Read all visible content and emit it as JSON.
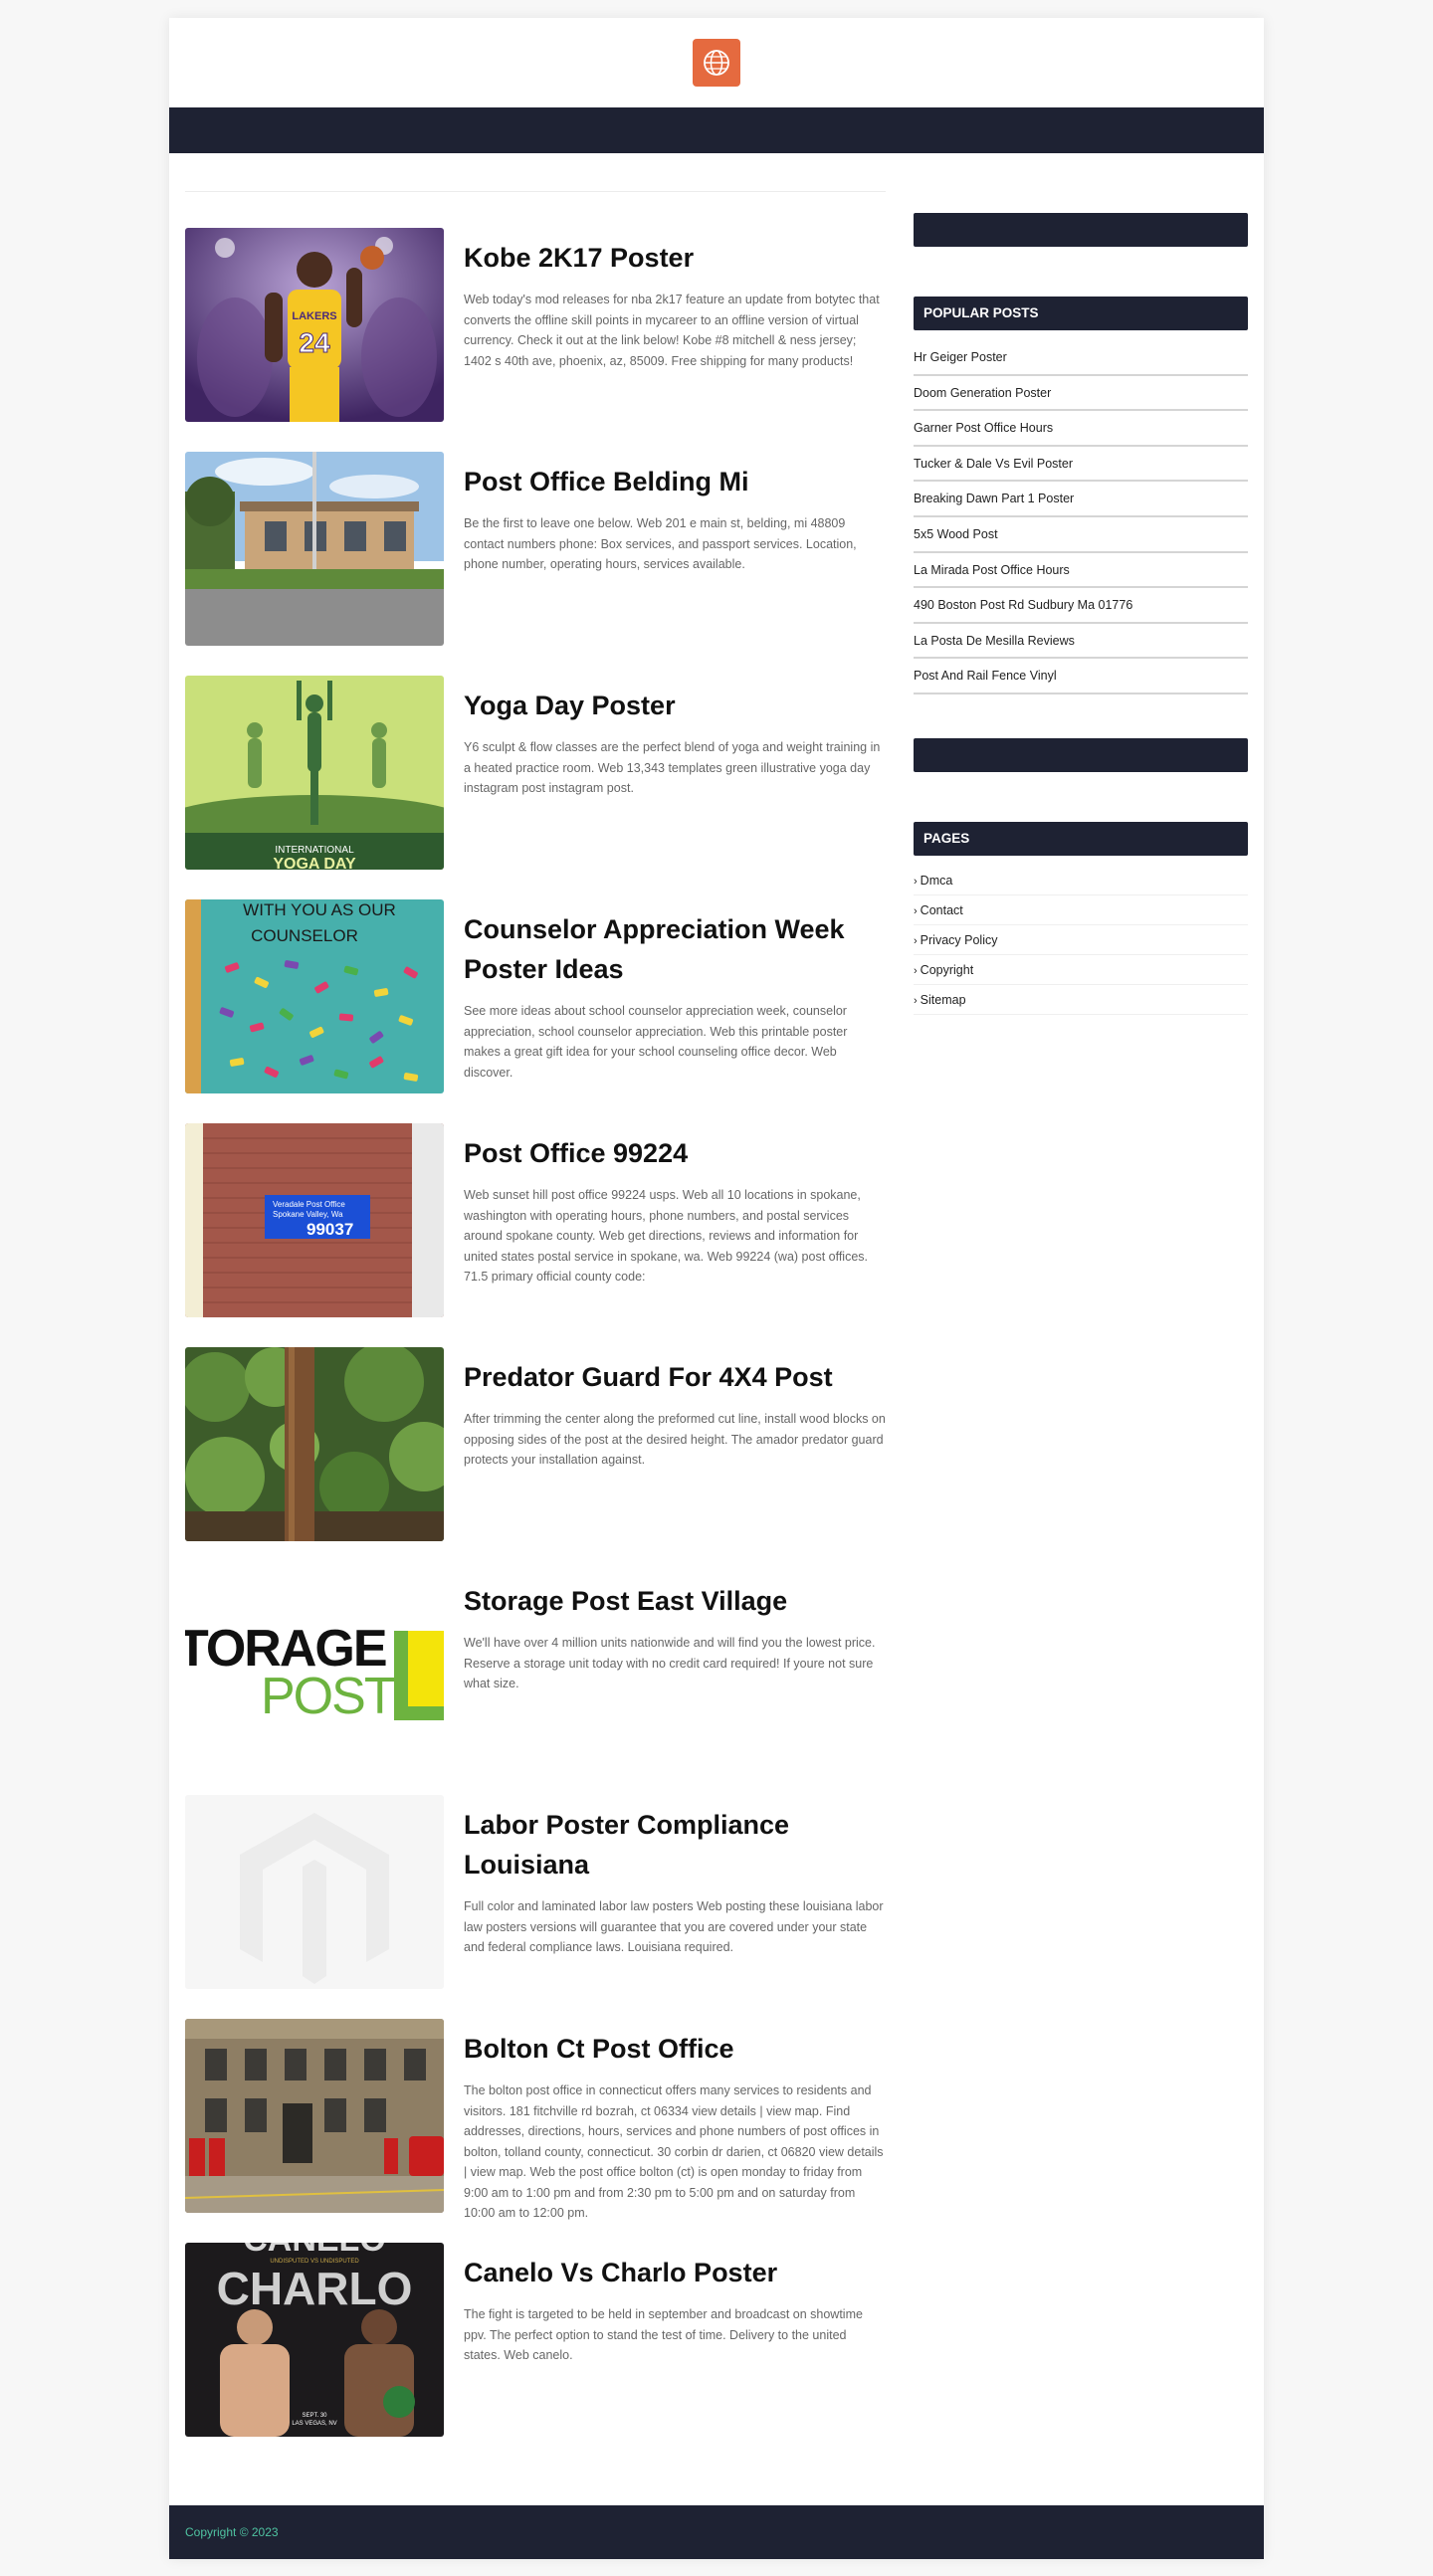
{
  "posts": [
    {
      "title": "Kobe 2K17 Poster",
      "excerpt": "Web today's mod releases for nba 2k17 feature an update from botytec that converts the offline skill points in mycareer to an offline version of virtual currency. Check it out at the link below! Kobe #8 mitchell & ness jersey; 1402 s 40th ave, phoenix, az, 85009. Free shipping for many products!",
      "image_text": [
        "LAKERS",
        "24"
      ]
    },
    {
      "title": "Post Office Belding Mi",
      "excerpt": "Be the first to leave one below. Web 201 e main st, belding, mi 48809 contact numbers phone: Box services, and passport services. Location, phone number, operating hours, services available."
    },
    {
      "title": "Yoga Day Poster",
      "excerpt": "Y6 sculpt & flow classes are the perfect blend of yoga and weight training in a heated practice room. Web 13,343 templates green illustrative yoga day instagram post instagram post.",
      "image_text": [
        "INTERNATIONAL",
        "YOGA DAY"
      ]
    },
    {
      "title": "Counselor Appreciation Week Poster Ideas",
      "excerpt": "See more ideas about school counselor appreciation week, counselor appreciation, school counselor appreciation. Web this printable poster makes a great gift idea for your school counseling office decor. Web discover.",
      "image_text": [
        "WITH YOU AS OUR",
        "COUNSELOR"
      ]
    },
    {
      "title": "Post Office 99224",
      "excerpt": "Web sunset hill post office 99224 usps. Web all 10 locations in spokane, washington with operating hours, phone numbers, and postal services around spokane county. Web get directions, reviews and information for united states postal service in spokane, wa. Web 99224 (wa) post offices. 71.5 primary official county code:",
      "image_text": [
        "Veradale Post Office",
        "Spokane Valley, Wa",
        "99037"
      ]
    },
    {
      "title": "Predator Guard For 4X4 Post",
      "excerpt": "After trimming the center along the preformed cut line, install wood blocks on opposing sides of the post at the desired height. The amador predator guard protects your installation against."
    },
    {
      "title": "Storage Post East Village",
      "excerpt": "We'll have over 4 million units nationwide and will find you the lowest price. Reserve a storage unit today with no credit card required! If youre not sure what size.",
      "image_text": [
        "TORAGE",
        "POST"
      ]
    },
    {
      "title": "Labor Poster Compliance Louisiana",
      "excerpt": "Full color and laminated labor law posters Web posting these louisiana labor law posters versions will guarantee that you are covered under your state and federal compliance laws. Louisiana required."
    },
    {
      "title": "Bolton Ct Post Office",
      "excerpt": "The bolton post office in connecticut offers many services to residents and visitors. 181 fitchville rd bozrah, ct 06334 view details | view map. Find addresses, directions, hours, services and phone numbers of post offices in bolton, tolland county, connecticut. 30 corbin dr darien, ct 06820 view details | view map. Web the post office bolton (ct) is open monday to friday from 9:00 am to 1:00 pm and from 2:30 pm to 5:00 pm and on saturday from 10:00 am to 12:00 pm."
    },
    {
      "title": "Canelo Vs Charlo Poster",
      "excerpt": "The fight is targeted to be held in september and broadcast on showtime ppv. The perfect option to stand the test of time. Delivery to the united states. Web canelo.",
      "image_text": [
        "CANELO",
        "UNDISPUTED VS UNDISPUTED",
        "CHARLO",
        "SEPT. 30",
        "LAS VEGAS, NV"
      ]
    }
  ],
  "sidebar": {
    "popular_title": "POPULAR POSTS",
    "popular": [
      "Hr Geiger Poster",
      "Doom Generation Poster",
      "Garner Post Office Hours",
      "Tucker & Dale Vs Evil Poster",
      "Breaking Dawn Part 1 Poster",
      "5x5 Wood Post",
      "La Mirada Post Office Hours",
      "490 Boston Post Rd Sudbury Ma 01776",
      "La Posta De Mesilla Reviews",
      "Post And Rail Fence Vinyl"
    ],
    "pages_title": "PAGES",
    "pages": [
      "Dmca",
      "Contact",
      "Privacy Policy",
      "Copyright",
      "Sitemap"
    ]
  },
  "footer": {
    "copyright": "Copyright © 2023"
  },
  "colors": {
    "dark": "#1e2233",
    "logo": "#e56a3f",
    "footer_text": "#4fc3a1"
  },
  "icons": {
    "logo": "globe-icon",
    "list_bullet": "chevron-right-icon"
  }
}
